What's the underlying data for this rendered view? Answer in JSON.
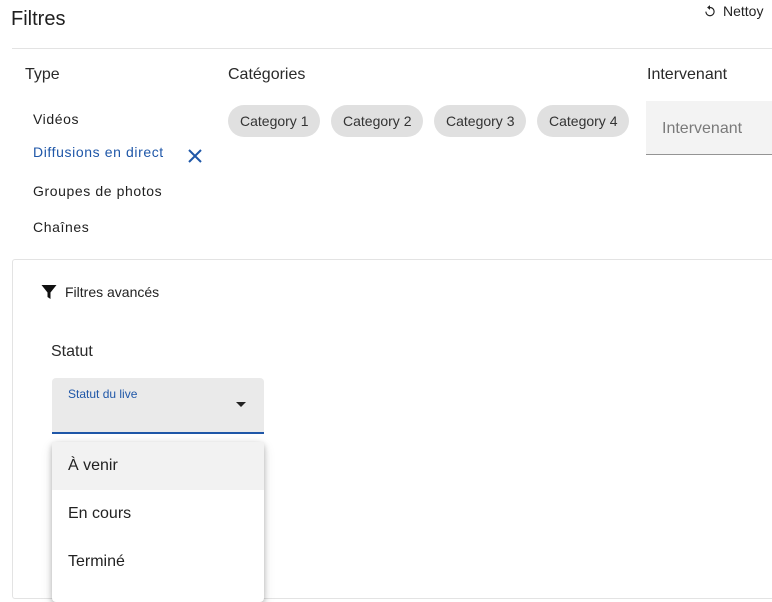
{
  "header": {
    "title": "Filtres",
    "reset_label": "Nettoy",
    "reset_icon": "reset-icon"
  },
  "type_filter": {
    "heading": "Type",
    "items": [
      {
        "label": "Vidéos",
        "active": false
      },
      {
        "label": "Diffusions en direct",
        "active": true
      },
      {
        "label": "Groupes de photos",
        "active": false
      },
      {
        "label": "Chaînes",
        "active": false
      }
    ],
    "active_color": "#1f57a8"
  },
  "categories": {
    "heading": "Catégories",
    "chips": [
      "Category 1",
      "Category 2",
      "Category 3",
      "Category 4"
    ]
  },
  "speaker": {
    "heading": "Intervenant",
    "placeholder": "Intervenant"
  },
  "advanced": {
    "label": "Filtres avancés",
    "icon": "filter-icon",
    "status_heading": "Statut",
    "select_label": "Statut du live",
    "options": [
      "À venir",
      "En cours",
      "Terminé"
    ],
    "highlighted": "À venir"
  }
}
